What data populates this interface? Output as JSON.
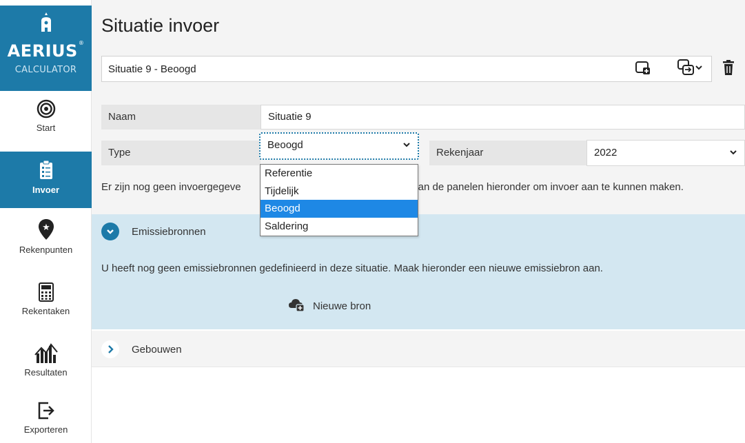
{
  "app": {
    "brand": "AERIUS",
    "brand_mark": "®",
    "subtitle": "CALCULATOR"
  },
  "sidebar": {
    "items": [
      {
        "label": "Start",
        "icon": "target-icon",
        "active": false
      },
      {
        "label": "Invoer",
        "icon": "clipboard-icon",
        "active": true
      },
      {
        "label": "Rekenpunten",
        "icon": "map-pin-star-icon",
        "active": false
      },
      {
        "label": "Rekentaken",
        "icon": "calculator-icon",
        "active": false
      },
      {
        "label": "Resultaten",
        "icon": "chart-icon",
        "active": false
      },
      {
        "label": "Exporteren",
        "icon": "export-icon",
        "active": false
      }
    ]
  },
  "header": {
    "title": "Situatie invoer",
    "scenario_selected": "Situatie 9 - Beoogd",
    "actions": [
      "add-scenario-icon",
      "copy-scenario-icon",
      "delete-scenario-icon"
    ]
  },
  "form": {
    "name_label": "Naam",
    "name_value": "Situatie 9",
    "type_label": "Type",
    "type_value": "Beoogd",
    "year_label": "Rekenjaar",
    "year_value": "2022",
    "type_options": [
      "Referentie",
      "Tijdelijk",
      "Beoogd",
      "Saldering"
    ],
    "type_selected_index": 2,
    "info_left": "Er zijn nog geen invoergegeve",
    "info_right": "n van de panelen hieronder om invoer aan te kunnen maken."
  },
  "panels": {
    "emission": {
      "title": "Emissiebronnen",
      "text": "U heeft nog geen emissiebronnen gedefinieerd in deze situatie. Maak hieronder een nieuwe emissiebron aan.",
      "new_source_label": "Nieuwe bron"
    },
    "buildings": {
      "title": "Gebouwen"
    }
  },
  "colors": {
    "accent": "#1d7aa8",
    "panel_bg": "#d3e7f1",
    "selected_option": "#1e88e5"
  }
}
